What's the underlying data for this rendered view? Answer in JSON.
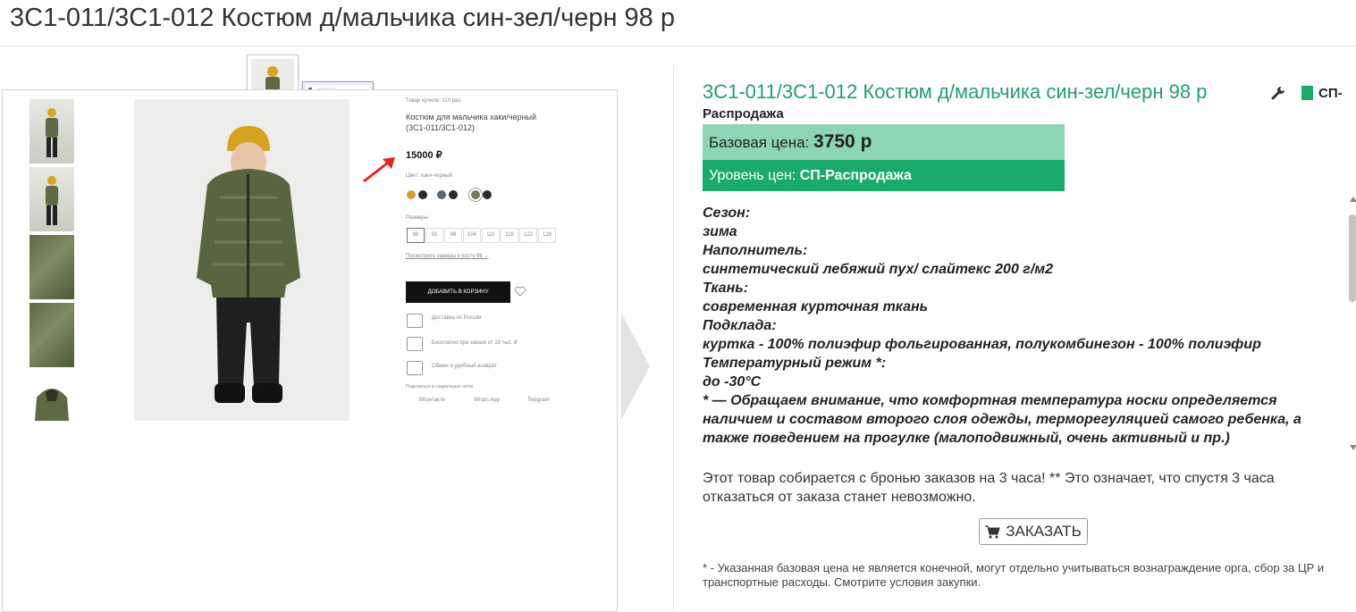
{
  "page_title": "3С1-011/3С1-012 Костюм д/мальчика син-зел/черн 98 р",
  "screenshot": {
    "bought_label": "Товар купили: 110 раз",
    "name_line1": "Костюм для мальчика хаки/черный",
    "name_line2": "(3С1-011/3С1-012)",
    "price": "15000 ₽",
    "color_label": "Цвет: хаки-черный",
    "sizes_label": "Размеры",
    "sizes": [
      "98",
      "92",
      "98",
      "104",
      "110",
      "116",
      "122",
      "128"
    ],
    "size_table_link": "Посмотреть замеры к росту 98 ⌄",
    "add_to_cart": "ДОБАВИТЬ В КОРЗИНУ",
    "delivery": "Доставка по России",
    "free_shipping": "Бесплатно при заказе от 18 тыс. ₽",
    "exchange": "Обмен и удобный возврат",
    "share_label": "Поделиться в социальных сетях",
    "vk": "ВКонтакте",
    "whatsapp": "Whats App",
    "telegram": "Telegram"
  },
  "product": {
    "title": "3С1-011/3С1-012 Костюм д/мальчика син-зел/черн 98 р",
    "tag_line1": "СП-",
    "tag_line2": "Распродажа",
    "base_price_label": "Базовая цена:",
    "base_price_value": "3750 р",
    "price_level_label": "Уровень цен:",
    "price_level_value": "СП-Распродажа"
  },
  "description": [
    "Сезон:",
    "зима",
    "Наполнитель:",
    "синтетический лебяжий пух/ слайтекс 200 г/м2",
    "Ткань:",
    "современная курточная ткань",
    "Подклада:",
    "куртка - 100% полиэфир фольгированная, полукомбинезон - 100% полиэфир",
    "Температурный режим *:",
    "до -30°C",
    "* — Обращаем внимание, что комфортная температура носки определяется наличием и составом второго слоя одежды, терморегуляцией самого ребенка, а также поведением на прогулке (малоподвижный, очень активный и пр.)"
  ],
  "note": "Этот товар собирается с бронью заказов на 3 часа! ** Это означает, что спустя 3 часа отказаться от заказа станет невозможно.",
  "order_button": "ЗАКАЗАТЬ",
  "footnote": "* - Указанная базовая цена не является конечной, могут отдельно учитываться вознаграждение орга, сбор за ЦР и транспортные расходы. Смотрите условия закупки.",
  "colors": {
    "accent_green": "#22a06b",
    "price_base_bg": "#8ed5b5",
    "price_level_bg": "#1aaa6a"
  }
}
